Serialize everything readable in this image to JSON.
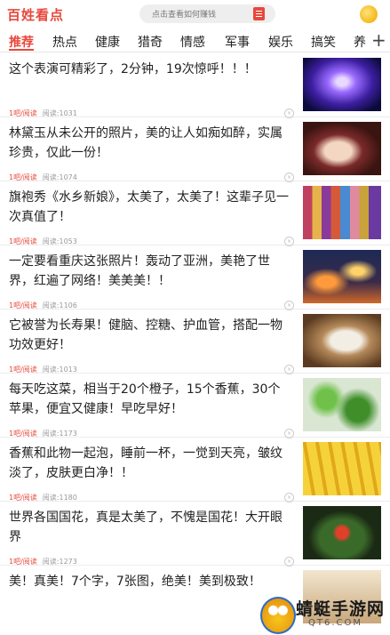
{
  "header": {
    "logo": "百姓看点",
    "search_placeholder": "点击查看如何赚钱"
  },
  "tabs": [
    "推荐",
    "热点",
    "健康",
    "猎奇",
    "情感",
    "军事",
    "娱乐",
    "搞笑",
    "养"
  ],
  "feed": [
    {
      "title": "这个表演可精彩了，2分钟，19次惊呼！！！",
      "source": "1吧/阅读",
      "reads": "阅读:1031",
      "thumb": "purple-performance-photo"
    },
    {
      "title": "林黛玉从未公开的照片，美的让人如痴如醉，实属珍贵，仅此一份！",
      "source": "1吧/阅读",
      "reads": "阅读:1074",
      "thumb": "portrait-photo"
    },
    {
      "title": "旗袍秀《水乡新娘》，太美了，太美了！这辈子见一次真值了！",
      "source": "1吧/阅读",
      "reads": "阅读:1053",
      "thumb": "qipao-show-photo"
    },
    {
      "title": "一定要看重庆这张照片！轰动了亚洲，美艳了世界，红遍了网络！美美美！！",
      "source": "1吧/阅读",
      "reads": "阅读:1106",
      "thumb": "chongqing-night-photo"
    },
    {
      "title": "它被誉为长寿果！健脑、控糖、护血管，搭配一物功效更好！",
      "source": "1吧/阅读",
      "reads": "阅读:1013",
      "thumb": "walnut-photo"
    },
    {
      "title": "每天吃这菜，相当于20个橙子，15个香蕉，30个苹果，便宜又健康！早吃早好！",
      "source": "1吧/阅读",
      "reads": "阅读:1173",
      "thumb": "greens-photo"
    },
    {
      "title": "香蕉和此物一起泡，睡前一杯，一觉到天亮，皱纹淡了，皮肤更白净！！",
      "source": "1吧/阅读",
      "reads": "阅读:1180",
      "thumb": "bananas-photo"
    },
    {
      "title": "世界各国国花，真是太美了，不愧是国花！大开眼界",
      "source": "1吧/阅读",
      "reads": "阅读:1273",
      "thumb": "flower-photo"
    },
    {
      "title": "美！真美！7个字，7张图，绝美！美到极致！",
      "source": "",
      "reads": "",
      "thumb": "landscape-photo"
    }
  ],
  "watermark": {
    "name": "蜻蜓手游网",
    "url": "QT6.COM"
  },
  "colors": {
    "accent": "#e8483c"
  }
}
